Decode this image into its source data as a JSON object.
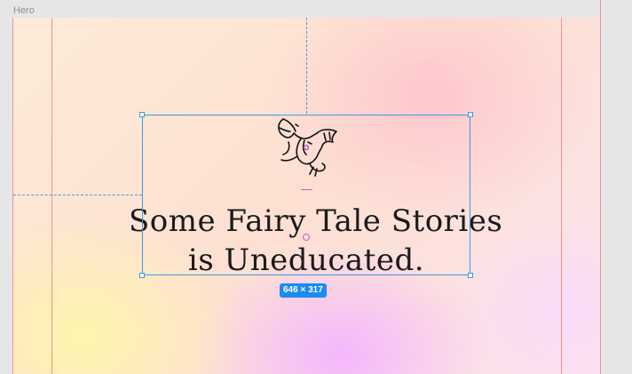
{
  "frame": {
    "label": "Hero"
  },
  "hero": {
    "headline_line1": "Some Fairy Tale Stories",
    "headline_line2": "is Uneducated."
  },
  "selection": {
    "size_badge": "646 × 317"
  },
  "icons": {
    "illustration": "dragon-icon"
  },
  "colors": {
    "selection": "#3b9be3",
    "badge": "#1b8cf0",
    "layout_grid": "#ec7878",
    "text": "#1a1a1a"
  }
}
